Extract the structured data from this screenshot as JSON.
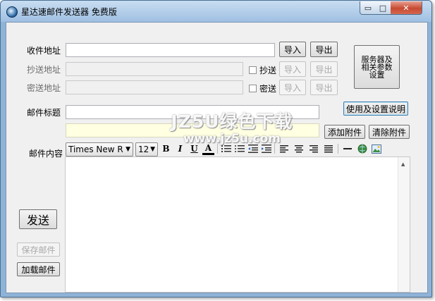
{
  "window": {
    "title": "星达速邮件发送器  免费版",
    "controls": {
      "minimize": "▭",
      "maximize": "□",
      "close": "✕"
    }
  },
  "form": {
    "to": {
      "label": "收件地址",
      "value": "",
      "import": "导入",
      "export": "导出"
    },
    "cc": {
      "label": "抄送地址",
      "value": "",
      "checkbox_label": "抄送",
      "checked": false,
      "import": "导入",
      "export": "导出"
    },
    "bcc": {
      "label": "密送地址",
      "value": "",
      "checkbox_label": "密送",
      "checked": false,
      "import": "导入",
      "export": "导出"
    },
    "server_settings_lines": [
      "服务器及",
      "相关参数",
      "设置"
    ],
    "subject": {
      "label": "邮件标题",
      "value": ""
    },
    "help_button": "使用及设置说明",
    "attachments": {
      "value": "",
      "add": "添加附件",
      "clear": "清除附件"
    },
    "content_label": "邮件内容"
  },
  "toolbar": {
    "font_family": "Times New R",
    "font_size": "12",
    "bold": "B",
    "italic": "I",
    "underline": "U",
    "font_color": "A",
    "icons": [
      "ordered-list-icon",
      "unordered-list-icon",
      "outdent-icon",
      "indent-icon",
      "align-left-icon",
      "align-center-icon",
      "align-right-icon",
      "justify-icon",
      "horizontal-rule-icon",
      "insert-link-icon",
      "insert-image-icon"
    ]
  },
  "actions": {
    "send": "发送",
    "save": "保存邮件",
    "load": "加载邮件"
  },
  "watermark": {
    "line1": "JZ5U绿色下载",
    "line2": "www.jz5u.com"
  },
  "colors": {
    "titlebar_top": "#c9ddf1",
    "titlebar_bottom": "#9fc0e2",
    "close_button": "#c74a32",
    "client_bg": "#f0f0f0",
    "attachment_bg": "#ffffe1"
  }
}
